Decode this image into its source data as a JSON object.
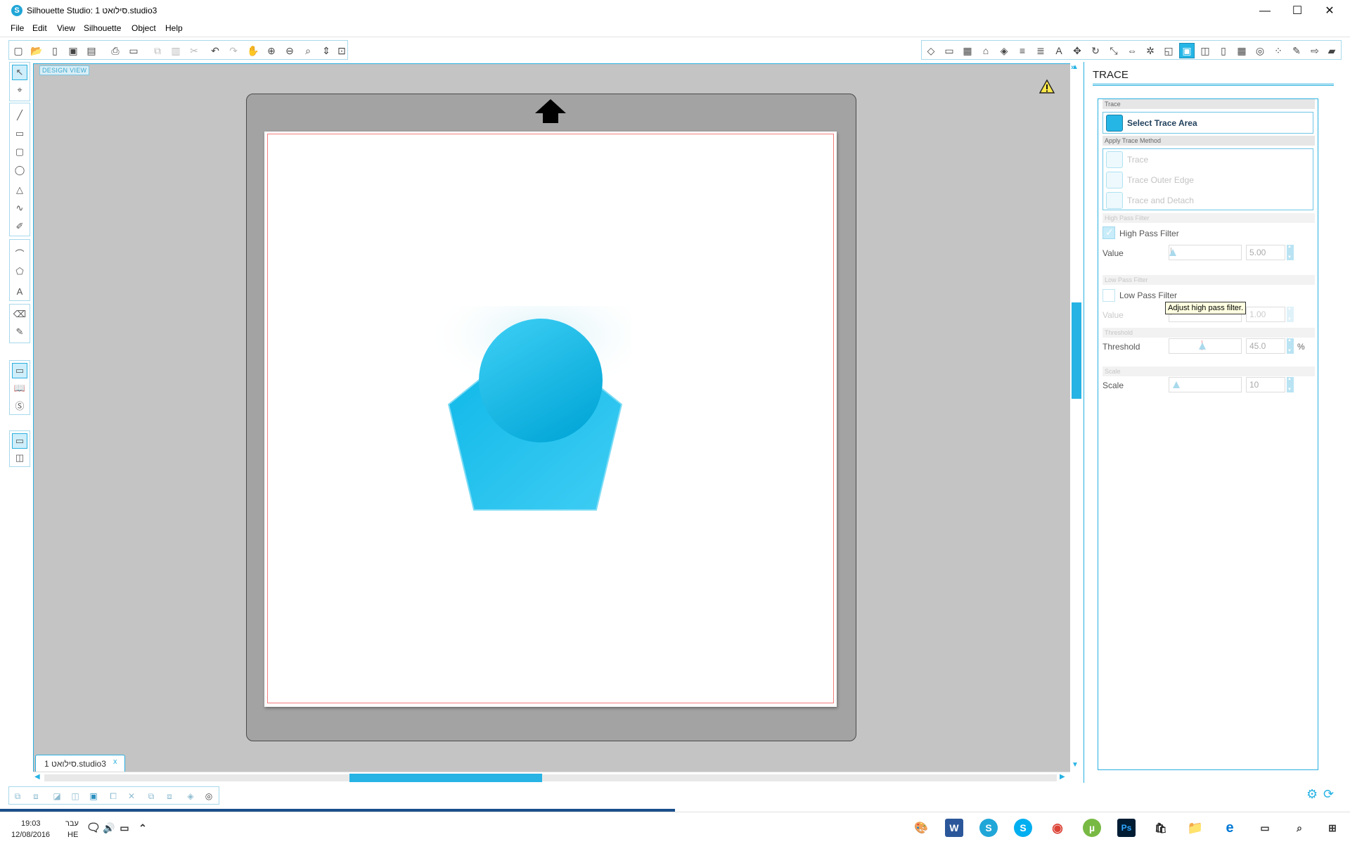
{
  "window": {
    "title": "Silhouette Studio: 1 סילואט.studio3",
    "app_icon": "S",
    "minimize": "—",
    "maximize": "☐",
    "close": "✕"
  },
  "menu": [
    "File",
    "Edit",
    "View",
    "Silhouette",
    "Object",
    "Help"
  ],
  "canvas": {
    "design_view_label": "DESIGN VIEW",
    "doc_tab": "1 סילואט.studio3",
    "doc_tab_close": "x"
  },
  "colors": {
    "accent": "#2ab0e0",
    "shape_fill": "#15bde9",
    "mat": "#a3a3a3",
    "canvas_bg": "#c4c4c4",
    "cut_border": "#f27b7b"
  },
  "trace_panel": {
    "title": "TRACE",
    "sections": {
      "trace": "Trace",
      "apply_method": "Apply Trace Method",
      "high_pass": "High Pass Filter",
      "low_pass": "Low Pass Filter",
      "threshold": "Threshold",
      "scale": "Scale"
    },
    "select_area_button": "Select Trace Area",
    "methods": [
      "Trace",
      "Trace Outer Edge",
      "Trace and Detach"
    ],
    "high_pass_filter": {
      "label": "High Pass Filter",
      "checked": true,
      "value_label": "Value",
      "value": "5.00"
    },
    "low_pass_filter": {
      "label": "Low Pass Filter",
      "checked": false,
      "value_label": "Value",
      "value": "1.00"
    },
    "threshold": {
      "label": "Threshold",
      "value": "45.0",
      "unit": "%"
    },
    "scale": {
      "label": "Scale",
      "value": "10"
    },
    "tooltip": "Adjust high pass filter."
  },
  "taskbar": {
    "time": "19:03",
    "date": "12/08/2016",
    "lang_top": "עבר",
    "lang_bottom": "HE",
    "apps": [
      "paint-icon",
      "word-icon",
      "silhouette-icon",
      "skype-icon",
      "chrome-icon",
      "utorrent-icon",
      "photoshop-icon",
      "store-icon",
      "explorer-icon",
      "edge-icon"
    ]
  }
}
